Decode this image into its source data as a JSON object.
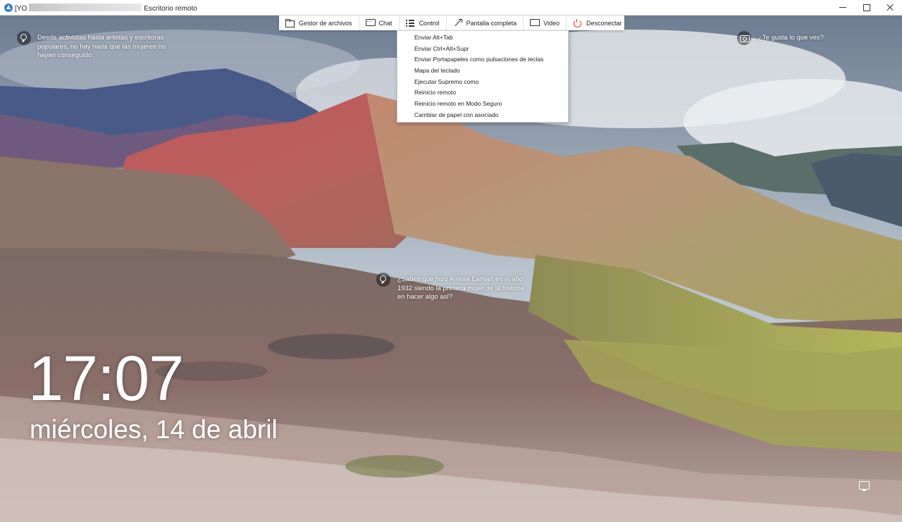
{
  "window": {
    "title_prefix": "[YO",
    "title_suffix": "Escritorio remoto",
    "controls": [
      "minimize-icon",
      "maximize-icon",
      "close-icon"
    ]
  },
  "toolbar": {
    "items": [
      {
        "label": "Gestor de archivos",
        "icon": "folder-icon"
      },
      {
        "label": "Chat",
        "icon": "chat-icon"
      },
      {
        "label": "Control",
        "icon": "list-icon"
      },
      {
        "label": "Pantalla completa",
        "icon": "fullscreen-icon"
      },
      {
        "label": "Video",
        "icon": "monitor-icon"
      },
      {
        "label": "Desconectar",
        "icon": "power-icon",
        "color": "#d9342b"
      }
    ]
  },
  "control_menu": {
    "items": [
      "Enviar Alt+Tab",
      "Enviar Ctrl+Alt+Supr",
      "Enviar Portapapeles como pulsaciones de teclas",
      "Mapa del teclado",
      "Ejecutar Supremo como",
      "Reinicio remoto",
      "Reinicio remoto en Modo Seguro",
      "Cambiar de papel con asociado"
    ]
  },
  "lockscreen": {
    "spotlight_top": "Desde activistas hasta artistas y escritoras populares, no hay nada que las mujeres no hayan conseguido",
    "like_prompt": "¿Te gusta lo que ves?",
    "spotlight_center": "¿Sabes qué hizo Amelia Earhart en el año 1932 siendo la primera mujer de la historia en hacer algo así?",
    "time": "17:07",
    "date": "miércoles, 14 de abril",
    "network_icon": "network-icon"
  }
}
